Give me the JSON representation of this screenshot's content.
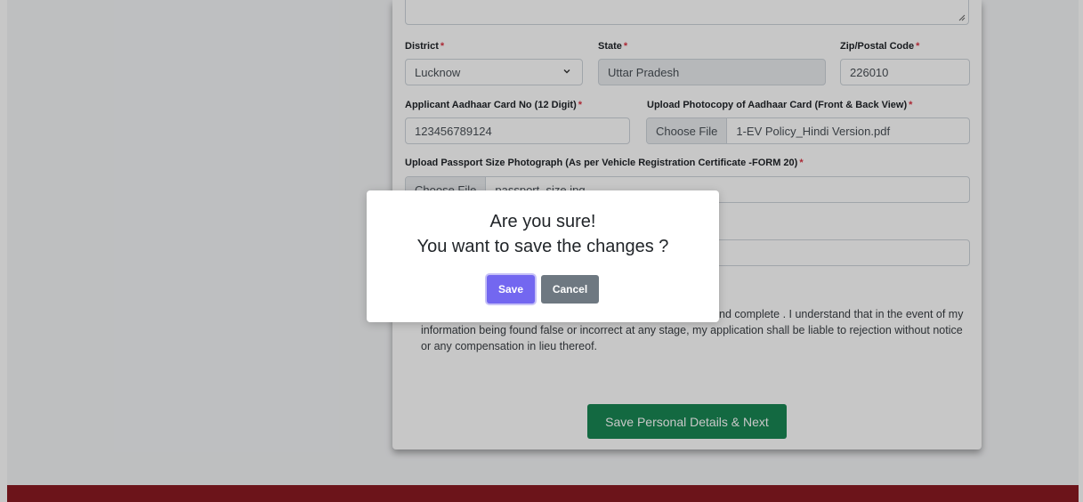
{
  "form": {
    "district": {
      "label": "District",
      "value": "Lucknow"
    },
    "state": {
      "label": "State",
      "value": "Uttar Pradesh"
    },
    "zip": {
      "label": "Zip/Postal Code",
      "value": "226010"
    },
    "aadhaar_no": {
      "label": "Applicant Aadhaar Card No (12 Digit)",
      "value": "123456789124"
    },
    "aadhaar_upload": {
      "label": "Upload Photocopy of Aadhaar Card (Front & Back View)",
      "button": "Choose File",
      "filename": "1-EV Policy_Hindi Version.pdf"
    },
    "photo_upload": {
      "label": "Upload Passport Size Photograph (As per Vehicle Registration Certificate -FORM 20)",
      "button": "Choose File",
      "filename": "passport_size.jpg"
    },
    "required_mark": "*",
    "declaration": {
      "line1": "nd complete . I understand that in the event of my",
      "line2": "information being found false or incorrect at any stage, my application shall be liable to rejection without notice",
      "line3": "or any compensation in lieu thereof."
    },
    "submit_label": "Save Personal Details & Next"
  },
  "modal": {
    "title_line1": "Are you sure!",
    "title_line2": "You want to save the changes ?",
    "save_label": "Save",
    "cancel_label": "Cancel"
  },
  "colors": {
    "primary": "#7367f0",
    "success": "#198754",
    "footer": "#8b1a22",
    "required": "#dc3545"
  }
}
